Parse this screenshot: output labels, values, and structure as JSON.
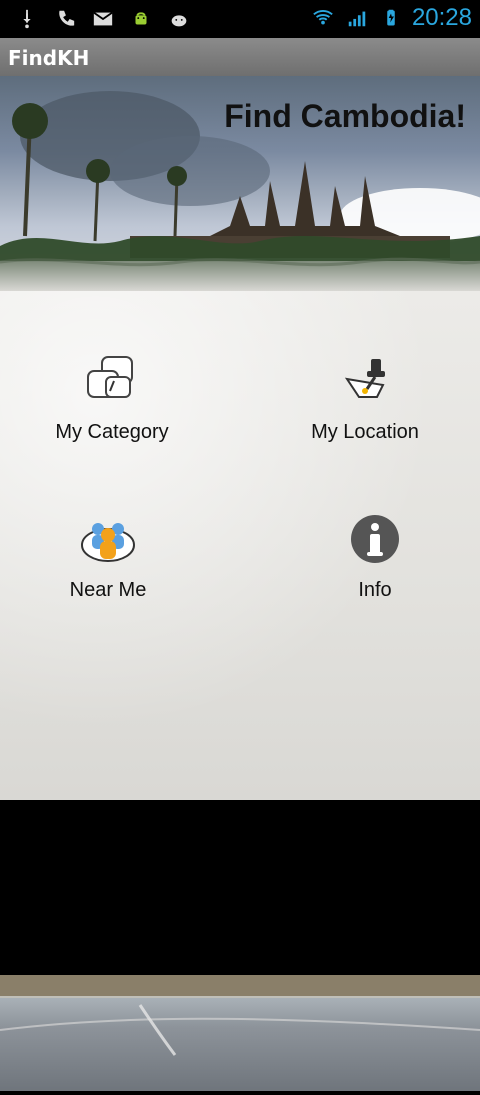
{
  "status": {
    "time": "20:28",
    "icons": [
      "usb-icon",
      "phone-icon",
      "gmail-icon",
      "android-icon",
      "android-robot-icon",
      "wifi-icon",
      "signal-icon",
      "battery-icon"
    ]
  },
  "app": {
    "title": "FindKH"
  },
  "hero": {
    "title": "Find Cambodia!"
  },
  "menu": {
    "items": [
      {
        "label": "My Category",
        "icon": "category-icon"
      },
      {
        "label": "My Location",
        "icon": "location-pin-icon"
      },
      {
        "label": "Near Me",
        "icon": "near-me-people-icon"
      },
      {
        "label": "Info",
        "icon": "info-icon"
      }
    ]
  },
  "colors": {
    "accent_clock": "#2aa7df",
    "title_bar": "#7f7f7f"
  }
}
